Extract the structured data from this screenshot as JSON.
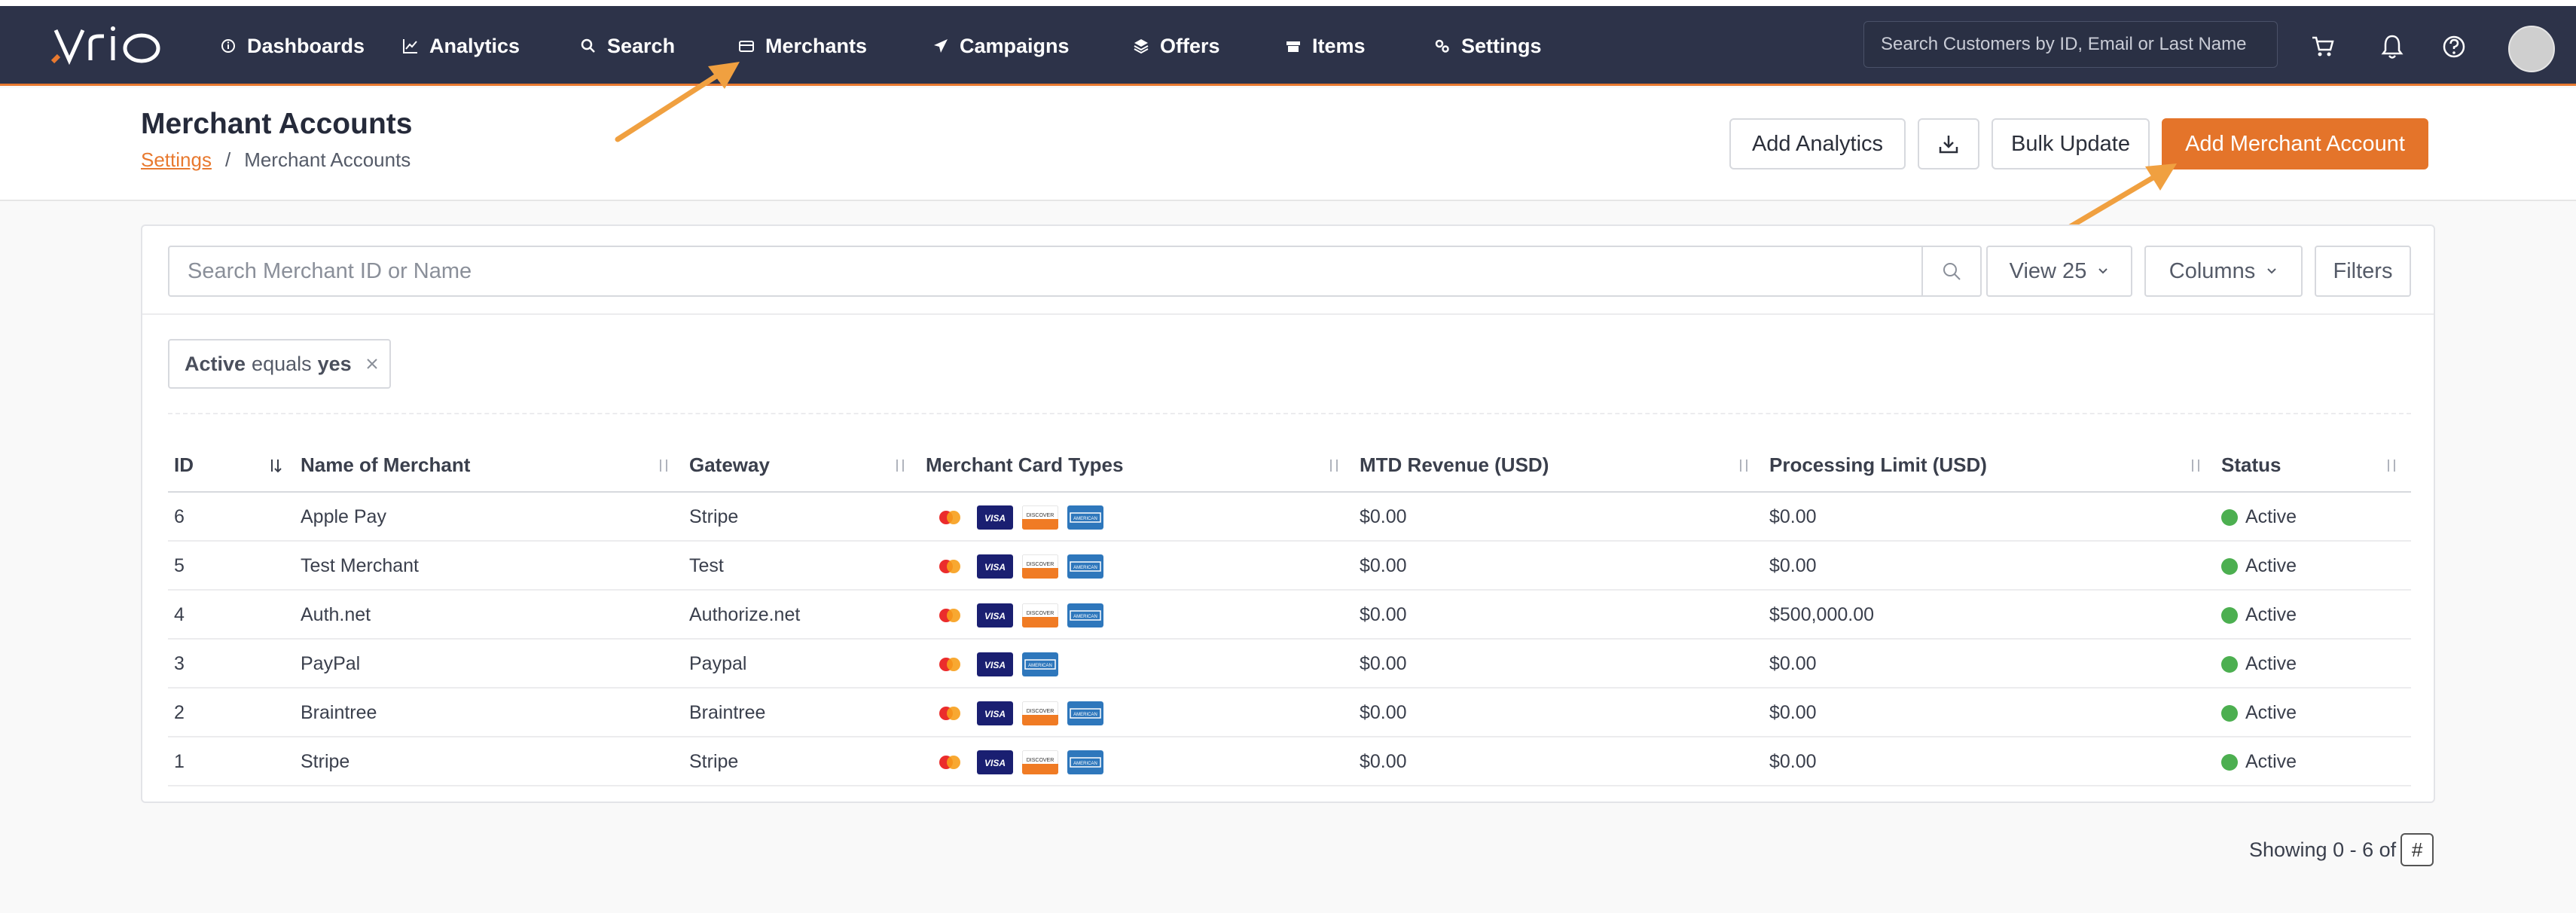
{
  "brand": {
    "logo_text": "vrio"
  },
  "nav": {
    "items": [
      {
        "label": "Dashboards",
        "icon": "info-circle-icon"
      },
      {
        "label": "Analytics",
        "icon": "line-chart-icon"
      },
      {
        "label": "Search",
        "icon": "search-icon"
      },
      {
        "label": "Merchants",
        "icon": "credit-card-icon",
        "active": true
      },
      {
        "label": "Campaigns",
        "icon": "paper-plane-icon"
      },
      {
        "label": "Offers",
        "icon": "layers-icon"
      },
      {
        "label": "Items",
        "icon": "box-icon"
      },
      {
        "label": "Settings",
        "icon": "gears-icon"
      }
    ],
    "search_placeholder": "Search Customers by ID, Email or Last Name",
    "icons": [
      "cart-icon",
      "bell-icon",
      "help-icon"
    ]
  },
  "header": {
    "title": "Merchant Accounts",
    "breadcrumb_link": "Settings",
    "breadcrumb_separator": "/",
    "breadcrumb_current": "Merchant Accounts",
    "buttons": {
      "add_analytics": "Add Analytics",
      "bulk_update": "Bulk Update",
      "add_merchant": "Add Merchant Account"
    }
  },
  "toolbar": {
    "search_placeholder": "Search Merchant ID or Name",
    "view": "View 25",
    "columns": "Columns",
    "filters": "Filters"
  },
  "filter_chip": {
    "field": "Active",
    "op": "equals",
    "value": "yes"
  },
  "table": {
    "columns": [
      "ID",
      "Name of Merchant",
      "Gateway",
      "Merchant Card Types",
      "MTD Revenue (USD)",
      "Processing Limit (USD)",
      "Status"
    ],
    "rows": [
      {
        "id": "6",
        "name": "Apple Pay",
        "gateway": "Stripe",
        "cards": [
          "mastercard",
          "visa",
          "discover",
          "amex"
        ],
        "revenue": "$0.00",
        "limit": "$0.00",
        "status": "Active"
      },
      {
        "id": "5",
        "name": "Test Merchant",
        "gateway": "Test",
        "cards": [
          "mastercard",
          "visa",
          "discover",
          "amex"
        ],
        "revenue": "$0.00",
        "limit": "$0.00",
        "status": "Active"
      },
      {
        "id": "4",
        "name": "Auth.net",
        "gateway": "Authorize.net",
        "cards": [
          "mastercard",
          "visa",
          "discover",
          "amex"
        ],
        "revenue": "$0.00",
        "limit": "$500,000.00",
        "status": "Active"
      },
      {
        "id": "3",
        "name": "PayPal",
        "gateway": "Paypal",
        "cards": [
          "mastercard",
          "visa",
          "amex"
        ],
        "revenue": "$0.00",
        "limit": "$0.00",
        "status": "Active"
      },
      {
        "id": "2",
        "name": "Braintree",
        "gateway": "Braintree",
        "cards": [
          "mastercard",
          "visa",
          "discover",
          "amex"
        ],
        "revenue": "$0.00",
        "limit": "$0.00",
        "status": "Active"
      },
      {
        "id": "1",
        "name": "Stripe",
        "gateway": "Stripe",
        "cards": [
          "mastercard",
          "visa",
          "discover",
          "amex"
        ],
        "revenue": "$0.00",
        "limit": "$0.00",
        "status": "Active"
      }
    ]
  },
  "footer": {
    "showing": "Showing 0 - 6 of",
    "hash": "#"
  },
  "colors": {
    "nav_bg": "#2d3349",
    "accent": "#e8792f",
    "status_active": "#4caf50"
  }
}
